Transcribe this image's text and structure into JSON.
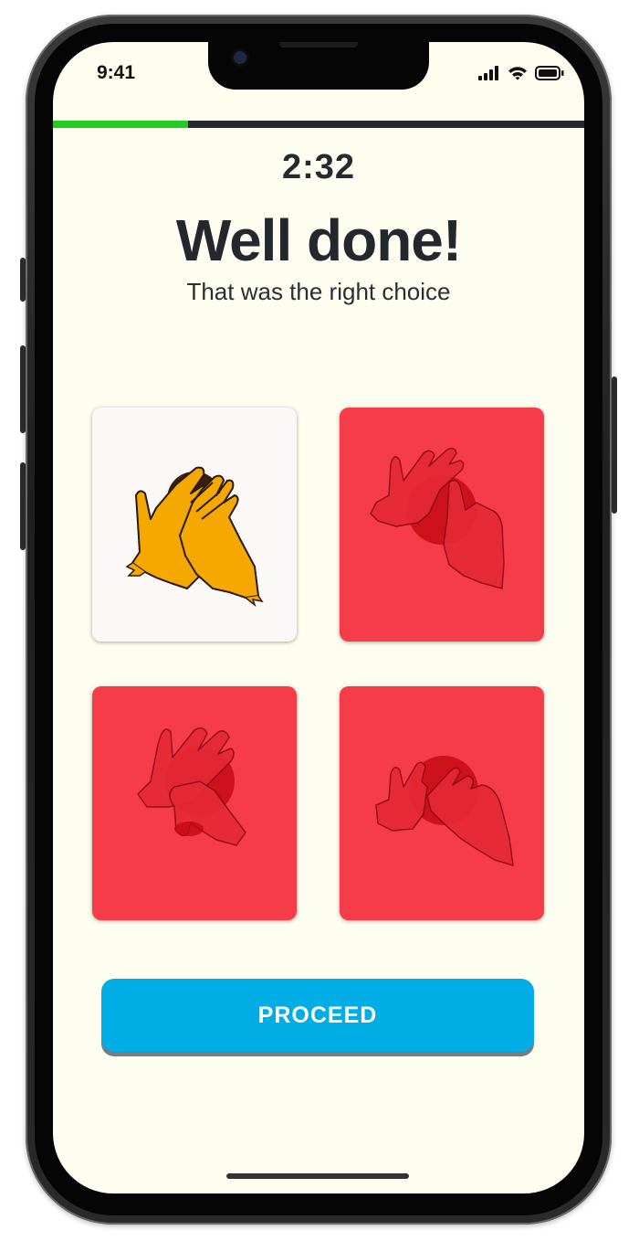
{
  "status_bar": {
    "time": "9:41"
  },
  "progress": {
    "fraction": 0.255,
    "fill_color": "#22cc22",
    "track_color": "#24292f"
  },
  "quiz": {
    "timer": "2:32",
    "headline": "Well done!",
    "subtitle": "That was the right choice"
  },
  "options": [
    {
      "name": "option-correct",
      "state": "correct"
    },
    {
      "name": "option-wrong-1",
      "state": "wrong"
    },
    {
      "name": "option-wrong-2",
      "state": "wrong"
    },
    {
      "name": "option-wrong-3",
      "state": "wrong"
    }
  ],
  "actions": {
    "proceed_label": "PROCEED"
  },
  "colors": {
    "background": "#fdfdf0",
    "correct_card": "#fbf8f8",
    "wrong_card": "#f53c48",
    "button": "#00aee5",
    "hand": "#f5a900"
  },
  "icons": [
    "signal-icon",
    "wifi-icon",
    "battery-icon",
    "hands-sign-icon"
  ]
}
